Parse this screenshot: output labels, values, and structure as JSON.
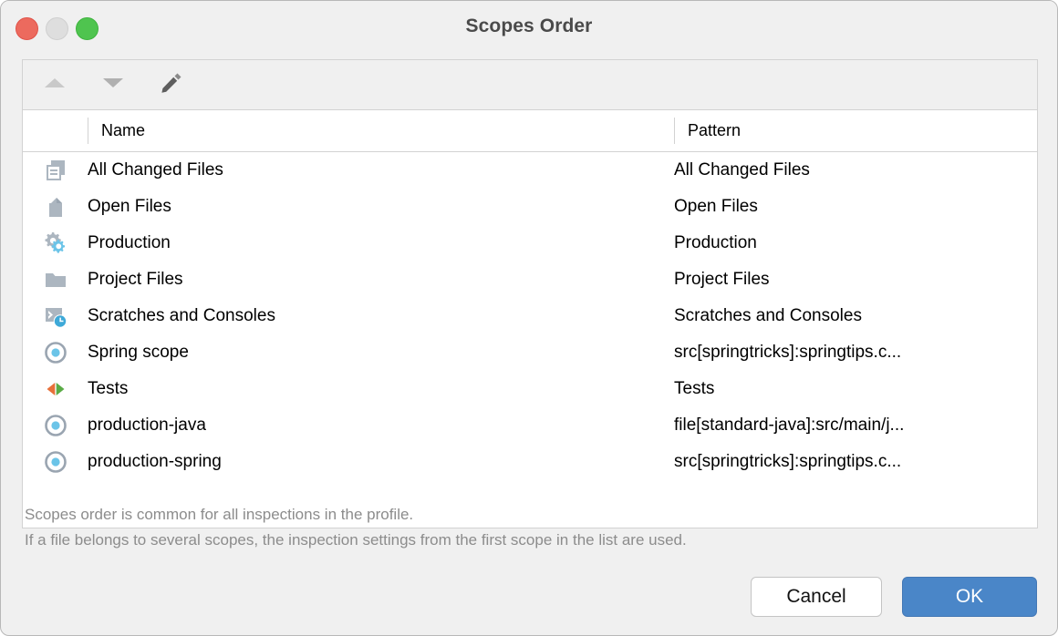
{
  "window": {
    "title": "Scopes Order",
    "traffic_lights": [
      {
        "name": "close",
        "color": "#ec6a5e"
      },
      {
        "name": "minimize",
        "color": "#dedede"
      },
      {
        "name": "zoom",
        "color": "#4fc44f"
      }
    ]
  },
  "toolbar": {
    "buttons": [
      {
        "icon": "move-up-icon",
        "label": "Move Up",
        "enabled": false
      },
      {
        "icon": "move-down-icon",
        "label": "Move Down",
        "enabled": true
      },
      {
        "icon": "edit-pencil-icon",
        "label": "Edit",
        "enabled": true
      }
    ]
  },
  "table": {
    "columns": [
      {
        "key": "icon",
        "label": ""
      },
      {
        "key": "name",
        "label": "Name"
      },
      {
        "key": "pattern",
        "label": "Pattern"
      }
    ],
    "rows": [
      {
        "icon": "all-changed-files-icon",
        "name": "All Changed Files",
        "pattern": "All Changed Files"
      },
      {
        "icon": "open-files-icon",
        "name": "Open Files",
        "pattern": "Open Files"
      },
      {
        "icon": "production-gears-icon",
        "name": "Production",
        "pattern": "Production"
      },
      {
        "icon": "project-files-folder-icon",
        "name": "Project Files",
        "pattern": "Project Files"
      },
      {
        "icon": "scratches-consoles-icon",
        "name": "Scratches and Consoles",
        "pattern": "Scratches and Consoles"
      },
      {
        "icon": "custom-scope-icon",
        "name": "Spring scope",
        "pattern": "src[springtricks]:springtips.c..."
      },
      {
        "icon": "tests-scope-icon",
        "name": "Tests",
        "pattern": "Tests"
      },
      {
        "icon": "custom-scope-icon",
        "name": "production-java",
        "pattern": "file[standard-java]:src/main/j..."
      },
      {
        "icon": "custom-scope-icon",
        "name": "production-spring",
        "pattern": "src[springtricks]:springtips.c..."
      }
    ]
  },
  "note": {
    "line1": "Scopes order is common for all inspections in the profile.",
    "line2": "If a file belongs to several scopes, the inspection settings from the first scope in the list are used."
  },
  "actions": {
    "cancel_label": "Cancel",
    "ok_label": "OK",
    "ok_color": "#4a86c8"
  }
}
